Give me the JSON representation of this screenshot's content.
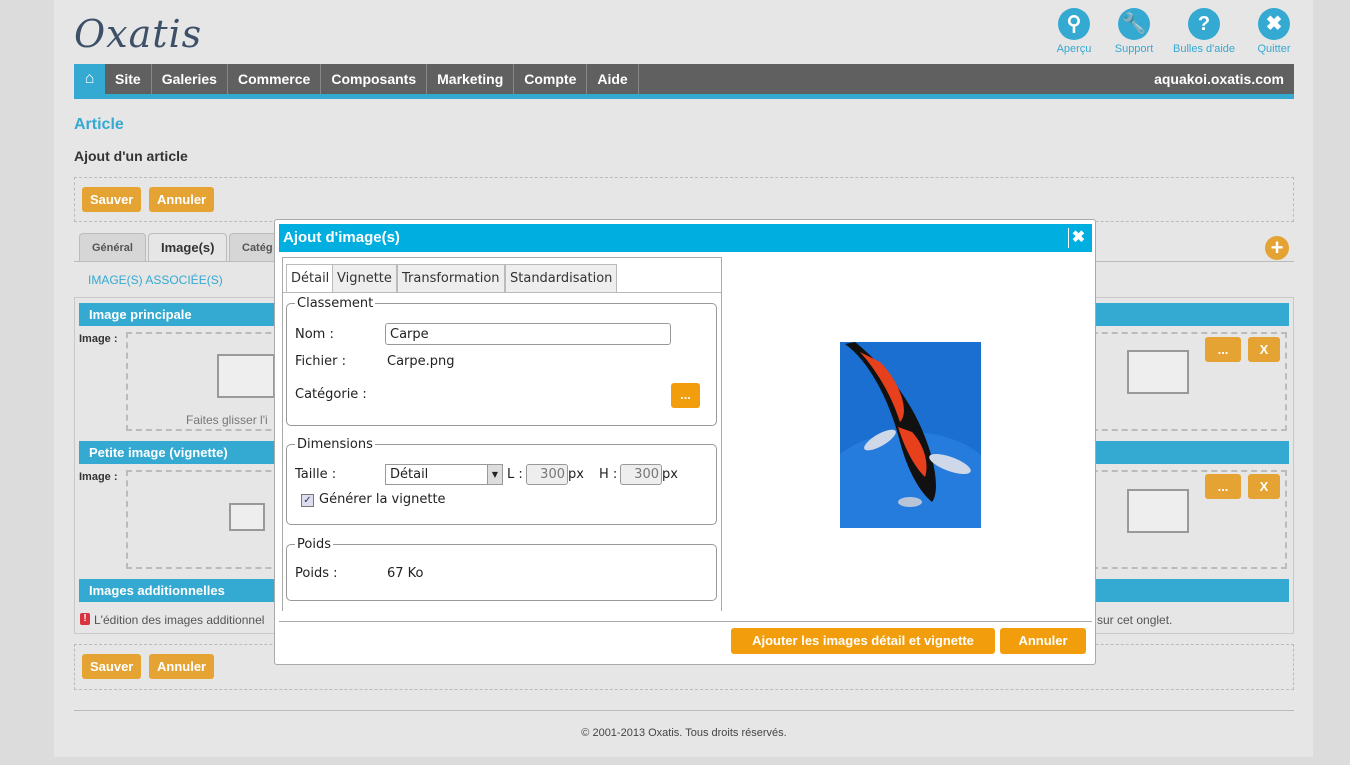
{
  "logo": "Oxatis",
  "top_actions": [
    {
      "label": "Aperçu",
      "icon": "search-icon"
    },
    {
      "label": "Support",
      "icon": "wrench-icon"
    },
    {
      "label": "Bulles d'aide",
      "icon": "help-icon"
    },
    {
      "label": "Quitter",
      "icon": "close-icon"
    }
  ],
  "nav": {
    "items": [
      "Site",
      "Galeries",
      "Commerce",
      "Composants",
      "Marketing",
      "Compte",
      "Aide"
    ],
    "site": "aquakoi.oxatis.com"
  },
  "page": {
    "title": "Article",
    "subtitle": "Ajout d'un article",
    "save": "Sauver",
    "cancel": "Annuler",
    "tabs": [
      "Général",
      "Image(s)",
      "Catég"
    ],
    "section_link": "IMAGE(S) ASSOCIÉE(S)",
    "sections": [
      "Image principale",
      "Petite image (vignette)",
      "Images additionnelles"
    ],
    "image_label": "Image :",
    "drop_hint": "Faites glisser l'i",
    "browse": "...",
    "remove": "X",
    "warning_left": "L'édition des images additionnel",
    "warning_right": "sur cet onglet.",
    "footer": "© 2001-2013 Oxatis. Tous droits réservés."
  },
  "modal": {
    "title": "Ajout d'image(s)",
    "tabs": [
      "Détail",
      "Vignette",
      "Transformation",
      "Standardisation"
    ],
    "classement": {
      "legend": "Classement",
      "nom_label": "Nom :",
      "nom_value": "Carpe",
      "fichier_label": "Fichier :",
      "fichier_value": "Carpe.png",
      "categorie_label": "Catégorie :",
      "browse": "..."
    },
    "dimensions": {
      "legend": "Dimensions",
      "taille_label": "Taille :",
      "taille_value": "Détail",
      "l_label": "L :",
      "l_value": "300",
      "h_label": "H :",
      "h_value": "300",
      "unit": "px",
      "generate_label": "Générer la vignette",
      "generate_checked": true
    },
    "poids": {
      "legend": "Poids",
      "label": "Poids :",
      "value": "67 Ko"
    },
    "add_button": "Ajouter les images détail et vignette",
    "cancel_button": "Annuler"
  },
  "colors": {
    "accent": "#34a9d1",
    "modal_header": "#00aee0",
    "button": "#e5a333",
    "modal_button": "#f29e0c",
    "nav": "#606060"
  }
}
